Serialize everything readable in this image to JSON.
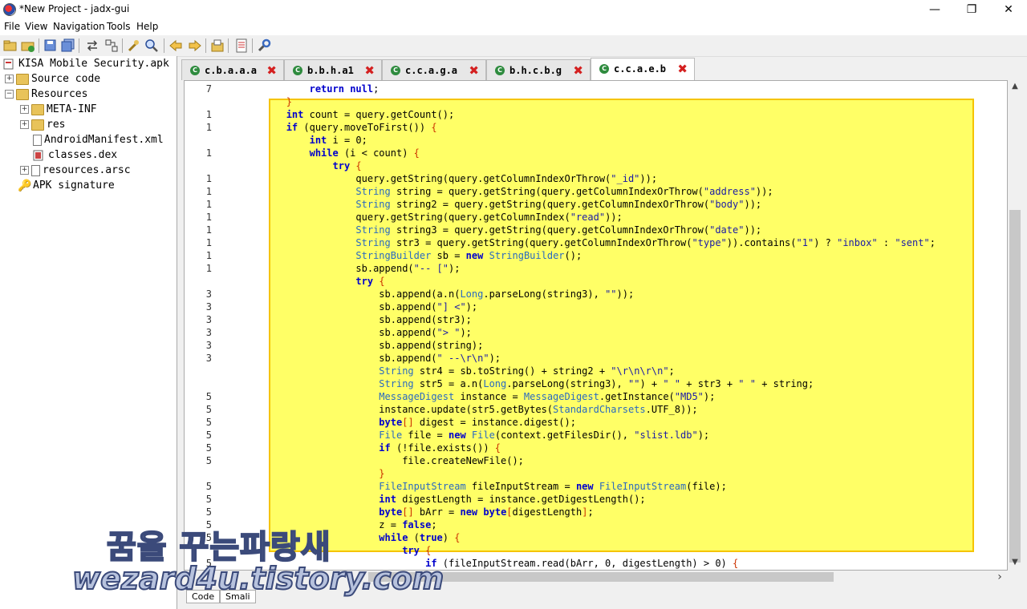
{
  "window": {
    "title": "*New Project - jadx-gui",
    "minimize": "—",
    "maximize": "❐",
    "close": "✕"
  },
  "menu": [
    "File",
    "View",
    "Navigation",
    "Tools",
    "Help"
  ],
  "toolbar": [
    "open-file",
    "add-file",
    "save",
    "save-all",
    "sync",
    "flatten",
    "search-text",
    "search-class",
    "back",
    "forward",
    "decompile",
    "log",
    "preferences"
  ],
  "tree": {
    "root": "KISA Mobile Security.apk",
    "items": [
      {
        "label": "Source code",
        "level": 1,
        "expander": "+",
        "icon": "folder"
      },
      {
        "label": "Resources",
        "level": 1,
        "expander": "−",
        "icon": "folder"
      },
      {
        "label": "META-INF",
        "level": 2,
        "expander": "+",
        "icon": "folder"
      },
      {
        "label": "res",
        "level": 2,
        "expander": "+",
        "icon": "folder"
      },
      {
        "label": "AndroidManifest.xml",
        "level": 2,
        "expander": "",
        "icon": "file"
      },
      {
        "label": "classes.dex",
        "level": 2,
        "expander": "",
        "icon": "file"
      },
      {
        "label": "resources.arsc",
        "level": 2,
        "expander": "+",
        "icon": "file"
      },
      {
        "label": "APK signature",
        "level": 1,
        "expander": "",
        "icon": "key"
      }
    ]
  },
  "tabs": [
    {
      "label": "c.b.a.a.a",
      "active": false
    },
    {
      "label": "b.b.h.a1",
      "active": false
    },
    {
      "label": "c.c.a.g.a",
      "active": false
    },
    {
      "label": "b.h.c.b.g",
      "active": false
    },
    {
      "label": "c.c.a.e.b",
      "active": true
    }
  ],
  "tab_close": "✖",
  "tab_icon": "C",
  "code_lines": [
    {
      "ln": "7",
      "code": "                return null;"
    },
    {
      "ln": "",
      "code": "            }"
    },
    {
      "ln": "1",
      "code": "            int count = query.getCount();"
    },
    {
      "ln": "1",
      "code": "            if (query.moveToFirst()) {"
    },
    {
      "ln": "",
      "code": "                int i = 0;"
    },
    {
      "ln": "1",
      "code": "                while (i < count) {"
    },
    {
      "ln": "",
      "code": "                    try {"
    },
    {
      "ln": "1",
      "code": "                        query.getString(query.getColumnIndexOrThrow(\"_id\"));"
    },
    {
      "ln": "1",
      "code": "                        String string = query.getString(query.getColumnIndexOrThrow(\"address\"));"
    },
    {
      "ln": "1",
      "code": "                        String string2 = query.getString(query.getColumnIndexOrThrow(\"body\"));"
    },
    {
      "ln": "1",
      "code": "                        query.getString(query.getColumnIndex(\"read\"));"
    },
    {
      "ln": "1",
      "code": "                        String string3 = query.getString(query.getColumnIndexOrThrow(\"date\"));"
    },
    {
      "ln": "1",
      "code": "                        String str3 = query.getString(query.getColumnIndexOrThrow(\"type\")).contains(\"1\") ? \"inbox\" : \"sent\";"
    },
    {
      "ln": "1",
      "code": "                        StringBuilder sb = new StringBuilder();"
    },
    {
      "ln": "1",
      "code": "                        sb.append(\"-- [\");"
    },
    {
      "ln": "",
      "code": "                        try {"
    },
    {
      "ln": "3",
      "code": "                            sb.append(a.n(Long.parseLong(string3), \"\"));"
    },
    {
      "ln": "3",
      "code": "                            sb.append(\"] <\");"
    },
    {
      "ln": "3",
      "code": "                            sb.append(str3);"
    },
    {
      "ln": "3",
      "code": "                            sb.append(\"> \");"
    },
    {
      "ln": "3",
      "code": "                            sb.append(string);"
    },
    {
      "ln": "3",
      "code": "                            sb.append(\" --\\r\\n\");"
    },
    {
      "ln": "",
      "code": "                            String str4 = sb.toString() + string2 + \"\\r\\n\\r\\n\";"
    },
    {
      "ln": "",
      "code": "                            String str5 = a.n(Long.parseLong(string3), \"\") + \" \" + str3 + \" \" + string;"
    },
    {
      "ln": "5",
      "code": "                            MessageDigest instance = MessageDigest.getInstance(\"MD5\");"
    },
    {
      "ln": "5",
      "code": "                            instance.update(str5.getBytes(StandardCharsets.UTF_8));"
    },
    {
      "ln": "5",
      "code": "                            byte[] digest = instance.digest();"
    },
    {
      "ln": "5",
      "code": "                            File file = new File(context.getFilesDir(), \"slist.ldb\");"
    },
    {
      "ln": "5",
      "code": "                            if (!file.exists()) {"
    },
    {
      "ln": "5",
      "code": "                                file.createNewFile();"
    },
    {
      "ln": "",
      "code": "                            }"
    },
    {
      "ln": "5",
      "code": "                            FileInputStream fileInputStream = new FileInputStream(file);"
    },
    {
      "ln": "5",
      "code": "                            int digestLength = instance.getDigestLength();"
    },
    {
      "ln": "5",
      "code": "                            byte[] bArr = new byte[digestLength];"
    },
    {
      "ln": "5",
      "code": "                            z = false;"
    },
    {
      "ln": "5",
      "code": "                            while (true) {"
    },
    {
      "ln": "",
      "code": "                                try {"
    },
    {
      "ln": "5",
      "code": "                                    if (fileInputStream.read(bArr, 0, digestLength) > 0) {"
    }
  ],
  "bottom_tabs": [
    "Code",
    "Smali"
  ],
  "watermark": {
    "line1": "꿈을 꾸는파랑새",
    "line2": "wezard4u.tistory.com"
  },
  "scroll": {
    "up": "▲",
    "down": "▼",
    "right": "›"
  },
  "colors": {
    "highlight": "#ffff66",
    "highlight_border": "#f5c400",
    "keyword": "#0000cc",
    "tab_close": "#d42020",
    "class_icon": "#2e8b3e"
  }
}
